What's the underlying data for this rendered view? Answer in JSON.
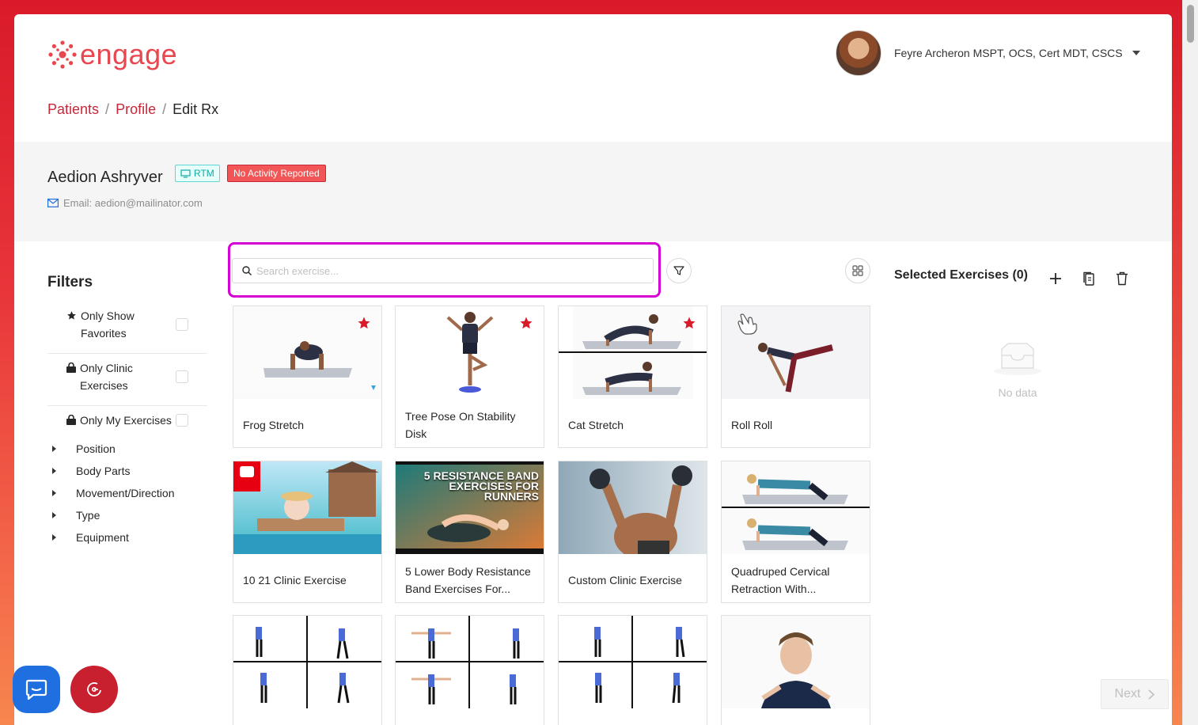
{
  "brand": {
    "name": "engage",
    "color": "#e8474f"
  },
  "user": {
    "name": "Feyre Archeron MSPT, OCS, Cert MDT, CSCS"
  },
  "breadcrumb": {
    "patients": "Patients",
    "profile": "Profile",
    "current": "Edit Rx",
    "sep": "/"
  },
  "patient": {
    "name": "Aedion Ashryver",
    "rtm_tag": "RTM",
    "status_tag": "No Activity Reported",
    "email": "Email: aedion@mailinator.com"
  },
  "filters": {
    "title": "Filters",
    "only_favorites": "Only Show Favorites",
    "only_clinic": "Only Clinic Exercises",
    "only_my": "Only My Exercises",
    "tree": [
      "Position",
      "Body Parts",
      "Movement/Direction",
      "Type",
      "Equipment"
    ]
  },
  "search": {
    "placeholder": "Search exercise..."
  },
  "exercises": [
    {
      "title": "Frog Stretch",
      "favorite": true
    },
    {
      "title": "Tree Pose On Stability Disk",
      "favorite": true
    },
    {
      "title": "Cat Stretch",
      "favorite": true
    },
    {
      "title": "Roll Roll",
      "favorite": false
    },
    {
      "title": "10 21 Clinic Exercise",
      "favorite": false
    },
    {
      "title": "5 Lower Body Resistance Band Exercises For...",
      "favorite": false,
      "thumb_text": "5 RESISTANCE BAND EXERCISES FOR RUNNERS"
    },
    {
      "title": "Custom Clinic Exercise",
      "favorite": false
    },
    {
      "title": "Quadruped Cervical Retraction With...",
      "favorite": false
    }
  ],
  "selected": {
    "title": "Selected Exercises (0)",
    "empty_text": "No data"
  },
  "next": {
    "label": "Next"
  },
  "colors": {
    "accent": "#c8283a",
    "highlight": "#d400d4",
    "star": "#d91a2a"
  }
}
